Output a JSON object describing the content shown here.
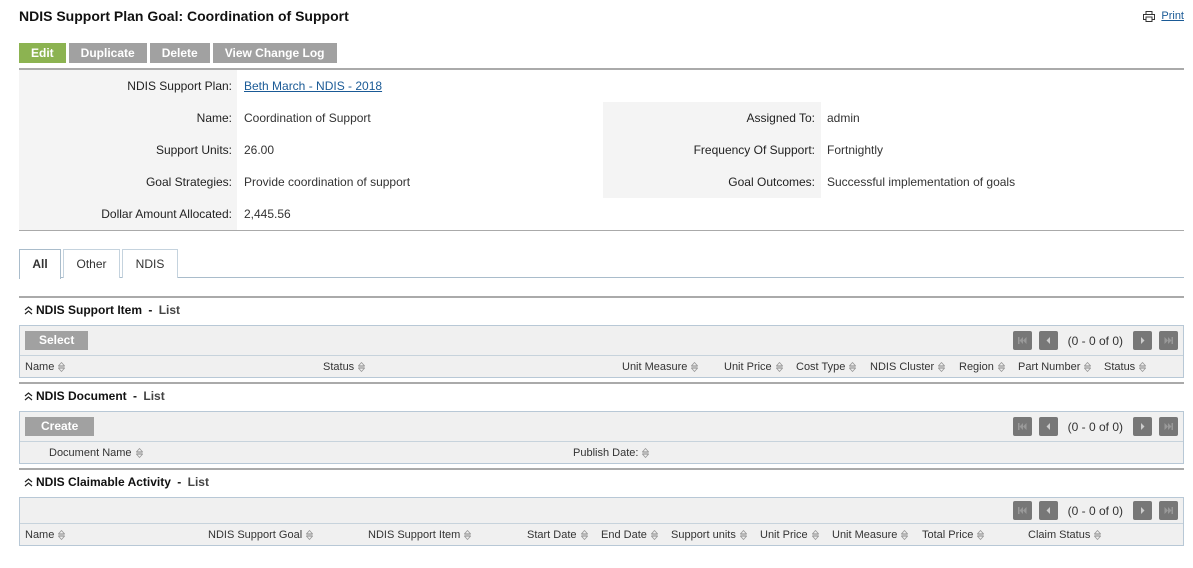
{
  "header": {
    "title": "NDIS Support Plan Goal: Coordination of Support",
    "print_label": "Print"
  },
  "actions": {
    "edit": "Edit",
    "duplicate": "Duplicate",
    "delete": "Delete",
    "change_log": "View Change Log"
  },
  "colors": {
    "edit_green": "#8cb351",
    "button_gray": "#a1a1a1",
    "link_blue": "#1a5a96"
  },
  "details": {
    "left": [
      {
        "label": "NDIS Support Plan:",
        "value": "Beth March - NDIS - 2018",
        "link": true
      },
      {
        "label": "Name:",
        "value": "Coordination of Support"
      },
      {
        "label": "Support Units:",
        "value": "26.00"
      },
      {
        "label": "Goal Strategies:",
        "value": "Provide coordination of support"
      },
      {
        "label": "Dollar Amount Allocated:",
        "value": "2,445.56"
      }
    ],
    "right": [
      {
        "label": "Assigned To:",
        "value": "admin"
      },
      {
        "label": "Frequency Of Support:",
        "value": "Fortnightly"
      },
      {
        "label": "Goal Outcomes:",
        "value": "Successful implementation of goals"
      }
    ]
  },
  "tabs": [
    {
      "label": "All",
      "active": true
    },
    {
      "label": "Other"
    },
    {
      "label": "NDIS"
    }
  ],
  "sections": {
    "support_item": {
      "title": "NDIS Support Item",
      "suffix": "List",
      "button": "Select",
      "pager": "(0 - 0 of 0)",
      "columns": [
        "Name",
        "Status",
        "Unit Measure",
        "Unit Price",
        "Cost Type",
        "NDIS Cluster",
        "Region",
        "Part Number",
        "Status"
      ]
    },
    "document": {
      "title": "NDIS Document",
      "suffix": "List",
      "button": "Create",
      "pager": "(0 - 0 of 0)",
      "columns": [
        "Document Name",
        "Publish Date:"
      ]
    },
    "claimable": {
      "title": "NDIS Claimable Activity",
      "suffix": "List",
      "pager": "(0 - 0 of 0)",
      "columns": [
        "Name",
        "NDIS Support Goal",
        "NDIS Support Item",
        "Start Date",
        "End Date",
        "Support units",
        "Unit Price",
        "Unit Measure",
        "Total Price",
        "Claim Status"
      ]
    }
  }
}
